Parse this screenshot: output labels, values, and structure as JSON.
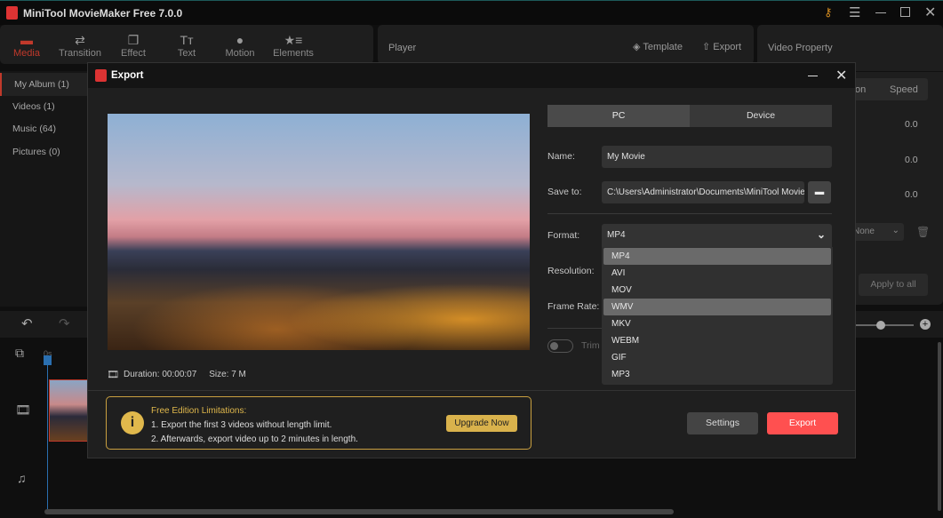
{
  "app": {
    "title": "MiniTool MovieMaker Free 7.0.0"
  },
  "toolbar": {
    "tabs": [
      {
        "label": "Media",
        "icon": "folder-icon"
      },
      {
        "label": "Transition",
        "icon": "swap-icon"
      },
      {
        "label": "Effect",
        "icon": "layers-icon"
      },
      {
        "label": "Text",
        "icon": "text-icon"
      },
      {
        "label": "Motion",
        "icon": "circle-icon"
      },
      {
        "label": "Elements",
        "icon": "star-icon"
      }
    ]
  },
  "player": {
    "title": "Player",
    "template": "Template",
    "export": "Export"
  },
  "property": {
    "title": "Video Property",
    "tab_partial": "on",
    "tab_speed": "Speed",
    "values": [
      "0.0",
      "0.0",
      "0.0"
    ],
    "select": "None",
    "apply_all": "Apply to all"
  },
  "sidebar": {
    "items": [
      "My Album (1)",
      "Videos (1)",
      "Music (64)",
      "Pictures (0)"
    ]
  },
  "timeline": {
    "time_marker": "0s"
  },
  "dialog": {
    "title": "Export",
    "info": {
      "duration_label": "Duration:",
      "duration": "00:00:07",
      "size_label": "Size:",
      "size": "7 M"
    },
    "notice": {
      "title": "Free Edition Limitations:",
      "line1": "1. Export the first 3 videos without length limit.",
      "line2": "2. Afterwards, export video up to 2 minutes in length.",
      "upgrade": "Upgrade Now"
    },
    "tabs": {
      "pc": "PC",
      "device": "Device"
    },
    "name_label": "Name:",
    "name_value": "My Movie",
    "save_label": "Save to:",
    "save_value": "C:\\Users\\Administrator\\Documents\\MiniTool Movie",
    "format_label": "Format:",
    "format_value": "MP4",
    "resolution_label": "Resolution:",
    "frame_rate_label": "Frame Rate:",
    "trim_label": "Trim",
    "format_options": [
      "MP4",
      "AVI",
      "MOV",
      "WMV",
      "MKV",
      "WEBM",
      "GIF",
      "MP3"
    ],
    "settings": "Settings",
    "export": "Export"
  },
  "colors": {
    "accent": "#ff5050",
    "gold": "#d9b24c",
    "media_active": "#c0392b"
  }
}
